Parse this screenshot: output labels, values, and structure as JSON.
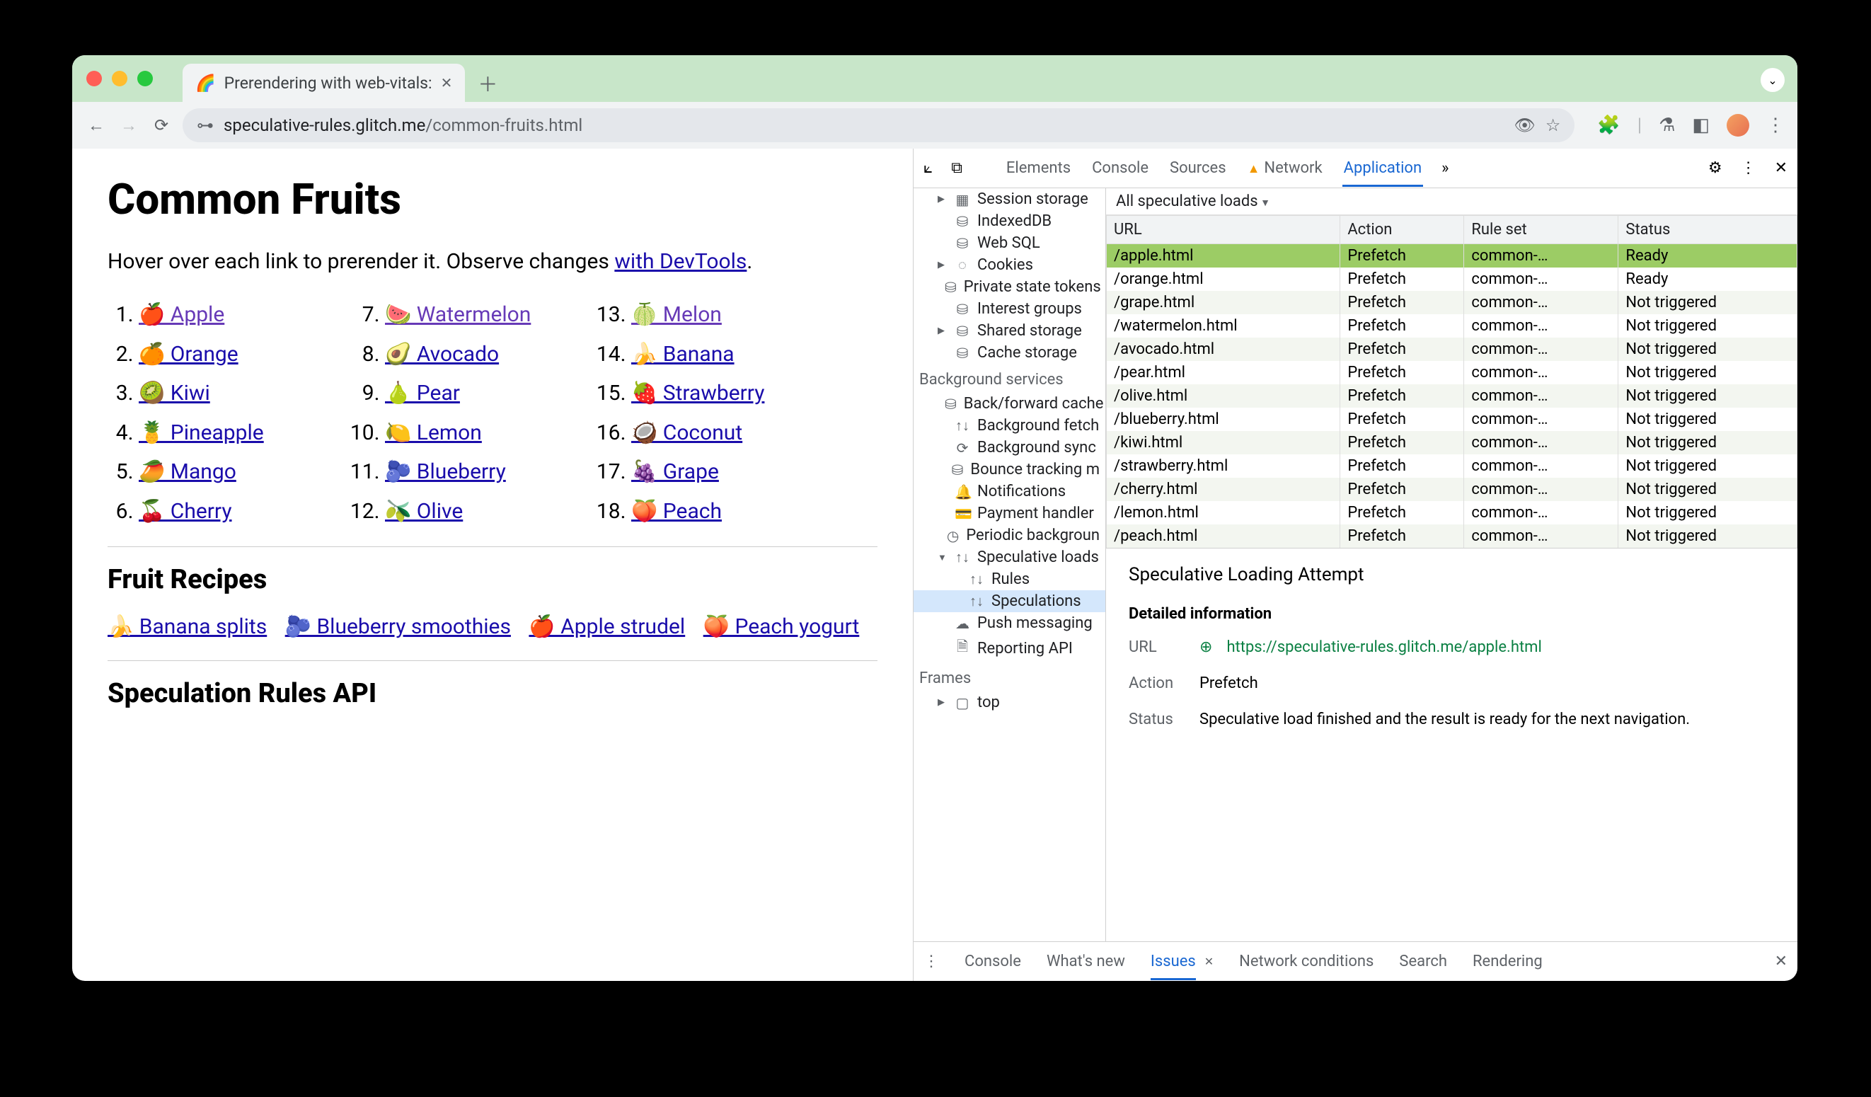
{
  "tab": {
    "favicon": "🌈",
    "title": "Prerendering with web-vitals:"
  },
  "url": {
    "prefix": "speculative-rules.glitch.me",
    "path": "/common-fruits.html"
  },
  "page": {
    "h1": "Common Fruits",
    "intro_a": "Hover over each link to prerender it. Observe changes ",
    "intro_link": "with DevTools",
    "intro_b": ".",
    "cols": [
      [
        {
          "e": "🍎",
          "t": "Apple"
        },
        {
          "e": "🍊",
          "t": "Orange"
        },
        {
          "e": "🥝",
          "t": "Kiwi"
        },
        {
          "e": "🍍",
          "t": "Pineapple"
        },
        {
          "e": "🥭",
          "t": "Mango"
        },
        {
          "e": "🍒",
          "t": "Cherry"
        }
      ],
      [
        {
          "e": "🍉",
          "t": "Watermelon"
        },
        {
          "e": "🥑",
          "t": "Avocado"
        },
        {
          "e": "🍐",
          "t": "Pear"
        },
        {
          "e": "🍋",
          "t": "Lemon"
        },
        {
          "e": "🫐",
          "t": "Blueberry"
        },
        {
          "e": "🫒",
          "t": "Olive"
        }
      ],
      [
        {
          "e": "🍈",
          "t": "Melon"
        },
        {
          "e": "🍌",
          "t": "Banana"
        },
        {
          "e": "🍓",
          "t": "Strawberry"
        },
        {
          "e": "🥥",
          "t": "Coconut"
        },
        {
          "e": "🍇",
          "t": "Grape"
        },
        {
          "e": "🍑",
          "t": "Peach"
        }
      ]
    ],
    "h2a": "Fruit Recipes",
    "recipes": [
      {
        "e": "🍌",
        "t": "Banana splits"
      },
      {
        "e": "🫐",
        "t": "Blueberry smoothies"
      },
      {
        "e": "🍎",
        "t": "Apple strudel"
      },
      {
        "e": "🍑",
        "t": "Peach yogurt"
      }
    ],
    "h2b": "Speculation Rules API"
  },
  "devtools": {
    "tabs": [
      "Elements",
      "Console",
      "Sources",
      "Network",
      "Application"
    ],
    "active_tab": "Application",
    "side_storage": [
      {
        "label": "Session storage",
        "icon": "▦",
        "tri": "▶"
      },
      {
        "label": "IndexedDB",
        "icon": "⛁"
      },
      {
        "label": "Web SQL",
        "icon": "⛁"
      },
      {
        "label": "Cookies",
        "icon": "◌",
        "tri": "▶"
      },
      {
        "label": "Private state tokens",
        "icon": "⛁"
      },
      {
        "label": "Interest groups",
        "icon": "⛁"
      },
      {
        "label": "Shared storage",
        "icon": "⛁",
        "tri": "▶"
      },
      {
        "label": "Cache storage",
        "icon": "⛁"
      }
    ],
    "bg_title": "Background services",
    "side_bg": [
      {
        "label": "Back/forward cache",
        "icon": "⛁"
      },
      {
        "label": "Background fetch",
        "icon": "↑↓"
      },
      {
        "label": "Background sync",
        "icon": "⟳"
      },
      {
        "label": "Bounce tracking m",
        "icon": "⛁"
      },
      {
        "label": "Notifications",
        "icon": "🔔"
      },
      {
        "label": "Payment handler",
        "icon": "💳"
      },
      {
        "label": "Periodic backgroun",
        "icon": "◷"
      },
      {
        "label": "Speculative loads",
        "icon": "↑↓",
        "tri": "▼"
      },
      {
        "label": "Rules",
        "icon": "↑↓",
        "sub": true
      },
      {
        "label": "Speculations",
        "icon": "↑↓",
        "sub": true,
        "sel": true
      },
      {
        "label": "Push messaging",
        "icon": "☁"
      },
      {
        "label": "Reporting API",
        "icon": "🗎"
      }
    ],
    "frames_title": "Frames",
    "frames": [
      {
        "label": "top",
        "icon": "▢",
        "tri": "▶"
      }
    ],
    "filter": "All speculative loads",
    "cols": [
      "URL",
      "Action",
      "Rule set",
      "Status"
    ],
    "rows": [
      {
        "url": "/apple.html",
        "action": "Prefetch",
        "rule": "common-…",
        "status": "Ready",
        "sel": true
      },
      {
        "url": "/orange.html",
        "action": "Prefetch",
        "rule": "common-…",
        "status": "Ready"
      },
      {
        "url": "/grape.html",
        "action": "Prefetch",
        "rule": "common-…",
        "status": "Not triggered"
      },
      {
        "url": "/watermelon.html",
        "action": "Prefetch",
        "rule": "common-…",
        "status": "Not triggered"
      },
      {
        "url": "/avocado.html",
        "action": "Prefetch",
        "rule": "common-…",
        "status": "Not triggered"
      },
      {
        "url": "/pear.html",
        "action": "Prefetch",
        "rule": "common-…",
        "status": "Not triggered"
      },
      {
        "url": "/olive.html",
        "action": "Prefetch",
        "rule": "common-…",
        "status": "Not triggered"
      },
      {
        "url": "/blueberry.html",
        "action": "Prefetch",
        "rule": "common-…",
        "status": "Not triggered"
      },
      {
        "url": "/kiwi.html",
        "action": "Prefetch",
        "rule": "common-…",
        "status": "Not triggered"
      },
      {
        "url": "/strawberry.html",
        "action": "Prefetch",
        "rule": "common-…",
        "status": "Not triggered"
      },
      {
        "url": "/cherry.html",
        "action": "Prefetch",
        "rule": "common-…",
        "status": "Not triggered"
      },
      {
        "url": "/lemon.html",
        "action": "Prefetch",
        "rule": "common-…",
        "status": "Not triggered"
      },
      {
        "url": "/peach.html",
        "action": "Prefetch",
        "rule": "common-…",
        "status": "Not triggered"
      }
    ],
    "detail": {
      "title": "Speculative Loading Attempt",
      "section": "Detailed information",
      "url_label": "URL",
      "url": "https://speculative-rules.glitch.me/apple.html",
      "action_label": "Action",
      "action": "Prefetch",
      "status_label": "Status",
      "status": "Speculative load finished and the result is ready for the next navigation."
    },
    "drawer": [
      "Console",
      "What's new",
      "Issues",
      "Network conditions",
      "Search",
      "Rendering"
    ]
  }
}
